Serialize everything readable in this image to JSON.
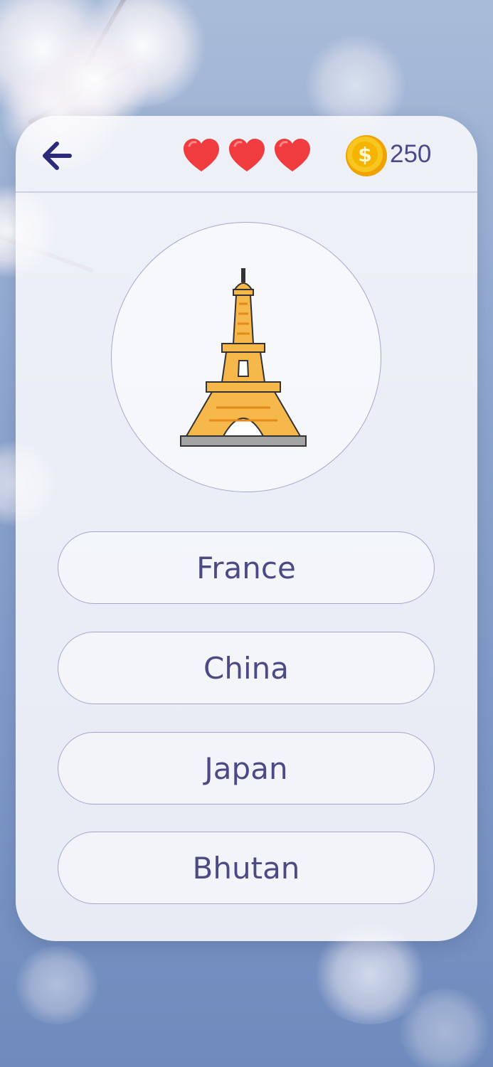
{
  "header": {
    "back_icon": "arrow-left-icon",
    "lives": [
      "heart-icon",
      "heart-icon",
      "heart-icon"
    ],
    "coin_icon": "dollar-coin-icon",
    "coins": "250"
  },
  "question": {
    "image": "eiffel-tower-icon"
  },
  "answers": [
    "France",
    "China",
    "Japan",
    "Bhutan"
  ],
  "colors": {
    "accent": "#4b4a88",
    "heart": "#f03b3f",
    "coin": "#f5c518",
    "tower": "#f7b84b"
  }
}
